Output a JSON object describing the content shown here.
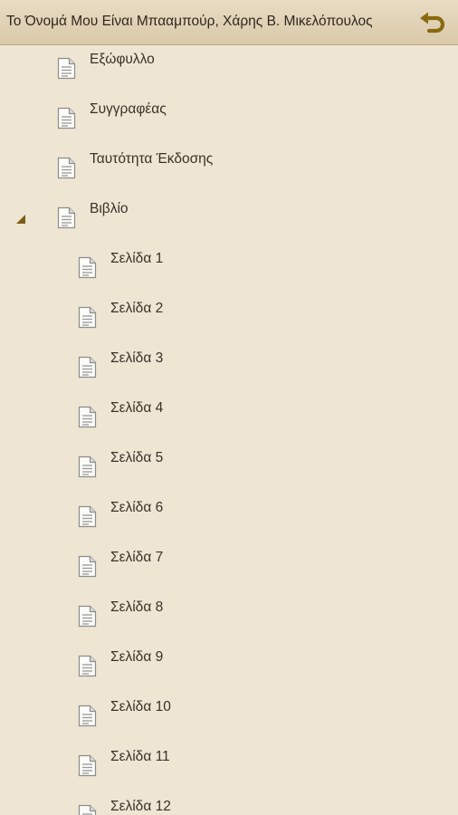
{
  "header": {
    "title": "Το Όνομά Μου Είναι Μπααμπούρ, Χάρης Β. Μικελόπουλος",
    "back_icon": "undo-arrow-icon",
    "accent_color": "#8a6a10"
  },
  "toc": {
    "items": [
      {
        "label": "Εξώφυλλο",
        "level": 0,
        "expanded": false,
        "icon": "document-icon"
      },
      {
        "label": "Συγγραφέας",
        "level": 0,
        "expanded": false,
        "icon": "document-icon"
      },
      {
        "label": "Ταυτότητα Έκδοσης",
        "level": 0,
        "expanded": false,
        "icon": "document-icon"
      },
      {
        "label": "Βιβλίο",
        "level": 0,
        "expanded": true,
        "icon": "document-icon"
      },
      {
        "label": "Σελίδα 1",
        "level": 1,
        "icon": "document-icon"
      },
      {
        "label": "Σελίδα 2",
        "level": 1,
        "icon": "document-icon"
      },
      {
        "label": "Σελίδα 3",
        "level": 1,
        "icon": "document-icon"
      },
      {
        "label": "Σελίδα 4",
        "level": 1,
        "icon": "document-icon"
      },
      {
        "label": "Σελίδα 5",
        "level": 1,
        "icon": "document-icon"
      },
      {
        "label": "Σελίδα 6",
        "level": 1,
        "icon": "document-icon"
      },
      {
        "label": "Σελίδα 7",
        "level": 1,
        "icon": "document-icon"
      },
      {
        "label": "Σελίδα 8",
        "level": 1,
        "icon": "document-icon"
      },
      {
        "label": "Σελίδα 9",
        "level": 1,
        "icon": "document-icon"
      },
      {
        "label": "Σελίδα 10",
        "level": 1,
        "icon": "document-icon"
      },
      {
        "label": "Σελίδα 11",
        "level": 1,
        "icon": "document-icon"
      },
      {
        "label": "Σελίδα 12",
        "level": 1,
        "icon": "document-icon"
      }
    ]
  }
}
